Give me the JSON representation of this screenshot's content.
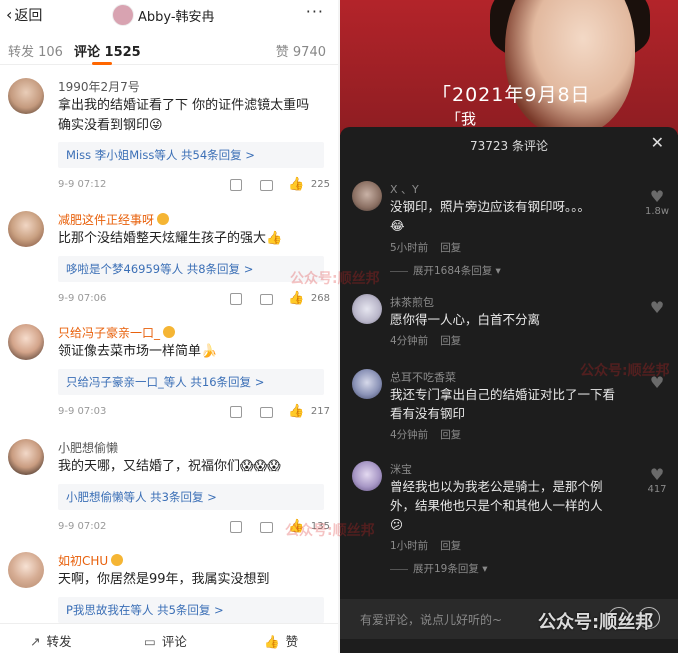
{
  "left": {
    "back_label": "返回",
    "user_name": "Abby-韩安冉",
    "more": "···",
    "tabs": {
      "repost": "转发 106",
      "comment": "评论 1525",
      "like": "赞 9740"
    },
    "comments": [
      {
        "name": "1990年2月7号",
        "text1": "拿出我的结婚证看了下 你的证件滤镜太重吗",
        "text2": "确实没看到钢印😜",
        "reply": "Miss 李小姐Miss等人  共54条回复 >",
        "time": "9-9 07:12",
        "likes": "225"
      },
      {
        "name": "减肥这件正经事呀",
        "text1": "比那个没结婚整天炫耀生孩子的强大👍",
        "reply": "哆啦是个梦46959等人  共8条回复 >",
        "time": "9-9 07:06",
        "likes": "268"
      },
      {
        "name": "只给冯子豪亲一口_",
        "text1": "领证像去菜市场一样简单🍌",
        "reply": "只给冯子豪亲一口_等人  共16条回复 >",
        "time": "9-9 07:03",
        "likes": "217"
      },
      {
        "name": "小肥想偷懒",
        "text1": "我的天哪，又结婚了，祝福你们😱😱😱",
        "reply": "小肥想偷懒等人  共3条回复 >",
        "time": "9-9 07:02",
        "likes": "135"
      },
      {
        "name": "如初CHU",
        "text1": "天啊，你居然是99年，我属实没想到",
        "reply": "P我思故我在等人  共5条回复 >"
      }
    ],
    "bottom": {
      "repost": "转发",
      "comment": "评论",
      "like": "赞"
    }
  },
  "right": {
    "date_text": "「2021年9月8日",
    "date_text2": "「我",
    "sheet_title": "73723 条评论",
    "close": "✕",
    "comments": [
      {
        "name": "X 、Y",
        "text1": "没钢印，照片旁边应该有钢印呀。。。",
        "text2": "😂",
        "time": "5小时前",
        "reply": "回复",
        "likes": "1.8w",
        "expand": "展开1684条回复 ▾"
      },
      {
        "name": "抹茶煎包",
        "text1": "愿你得一人心，白首不分离",
        "time": "4分钟前",
        "reply": "回复"
      },
      {
        "name": "总耳不吃香菜",
        "text1": "我还专门拿出自己的结婚证对比了一下看",
        "text2": "看有没有钢印",
        "time": "4分钟前",
        "reply": "回复"
      },
      {
        "name": "洣宝",
        "text1": "曾经我也以为我老公是骑士，是那个例",
        "text2": "外，结果他也只是个和其他人一样的人",
        "text3": "😕",
        "time": "1小时前",
        "reply": "回复",
        "likes": "417",
        "expand": "展开19条回复 ▾"
      }
    ],
    "input_placeholder": "有爱评论，说点儿好听的~"
  },
  "watermark": "公众号:顺丝邦",
  "colors": {
    "accent_orange": "#f60",
    "link_blue": "#3b6fb6",
    "dark_bg": "#1d1d1d",
    "video_red": "#b3242a"
  }
}
